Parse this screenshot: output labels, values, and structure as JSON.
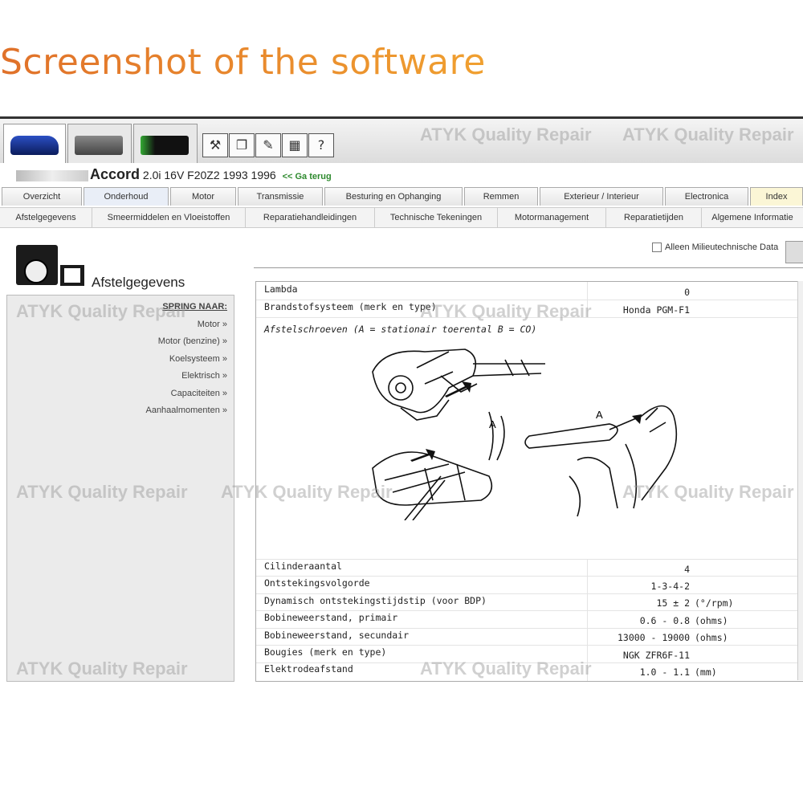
{
  "heading": "Screenshot of the software",
  "watermark": "ATYK Quality Repair",
  "toolbar": {
    "car_tabs": [
      "car-photo-icon",
      "engine-photo-icon",
      "battery-photo-icon"
    ],
    "buttons": [
      "tools-icon",
      "copy-icon",
      "edit-icon",
      "calculator-icon",
      "help-icon"
    ]
  },
  "vehicle": {
    "model": "Accord",
    "details": "2.0i 16V F20Z2 1993 1996",
    "back_link": "<< Ga terug"
  },
  "main_tabs": [
    "Overzicht",
    "Onderhoud",
    "Motor",
    "Transmissie",
    "Besturing en Ophanging",
    "Remmen",
    "Exterieur / Interieur",
    "Electronica",
    "Index"
  ],
  "sub_tabs": [
    "Afstelgegevens",
    "Smeermiddelen en Vloeistoffen",
    "Reparatiehandleidingen",
    "Technische Tekeningen",
    "Motormanagement",
    "Reparatietijden",
    "Algemene Informatie"
  ],
  "section": {
    "title": "Afstelgegevens"
  },
  "jump": {
    "title": "SPRING NAAR:",
    "links": [
      "Motor »",
      "Motor (benzine) »",
      "Koelsysteem »",
      "Elektrisch »",
      "Capaciteiten »",
      "Aanhaalmomenten »"
    ]
  },
  "filter": {
    "label": "Alleen Milieutechnische Data"
  },
  "rows_top": [
    {
      "label": "Lambda",
      "value": "0",
      "unit": ""
    },
    {
      "label": "Brandstofsysteem (merk en type)",
      "value": "Honda PGM-F1",
      "unit": ""
    }
  ],
  "diagram": {
    "caption": "Afstelschroeven (A = stationair toerental B = CO)",
    "label_a1": "A",
    "label_a2": "A"
  },
  "rows_bottom": [
    {
      "label": "Cilinderaantal",
      "value": "4",
      "unit": ""
    },
    {
      "label": "Ontstekingsvolgorde",
      "value": "1-3-4-2",
      "unit": ""
    },
    {
      "label": "Dynamisch ontstekingstijdstip (voor BDP)",
      "value": "15 ± 2",
      "unit": "(°/rpm)"
    },
    {
      "label": "Bobineweerstand, primair",
      "value": "0.6 - 0.8",
      "unit": "(ohms)"
    },
    {
      "label": "Bobineweerstand, secundair",
      "value": "13000 - 19000",
      "unit": "(ohms)"
    },
    {
      "label": "Bougies (merk en type)",
      "value": "NGK ZFR6F-11",
      "unit": ""
    },
    {
      "label": "Elektrodeafstand",
      "value": "1.0 - 1.1",
      "unit": "(mm)"
    }
  ],
  "colors": {
    "heading": "#e88a2c",
    "back_link": "#2e8a2e",
    "index_tab": "#fbf6d6"
  }
}
